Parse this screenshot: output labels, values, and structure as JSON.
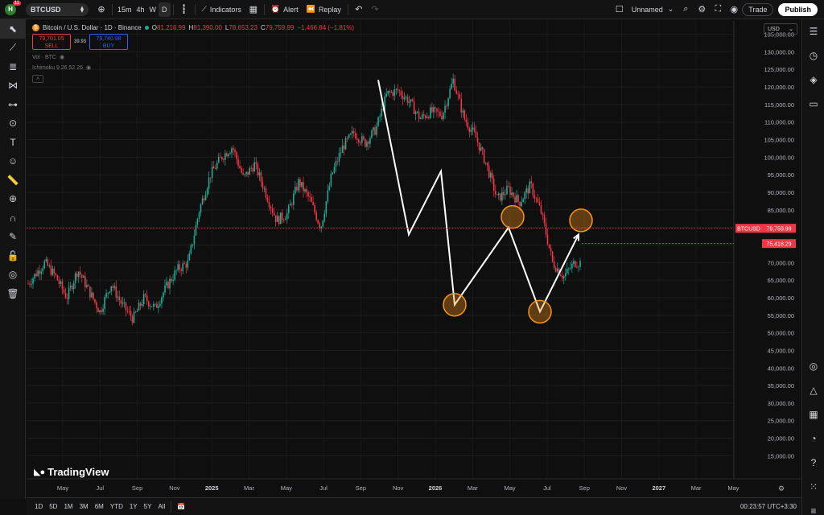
{
  "topbar": {
    "avatar_letter": "H",
    "notification_count": "11",
    "symbol": "BTCUSD",
    "timeframes": [
      "15m",
      "4h",
      "W",
      "D"
    ],
    "active_timeframe": "D",
    "indicators_label": "Indicators",
    "alert_label": "Alert",
    "replay_label": "Replay",
    "layout_name": "Unnamed",
    "trade_label": "Trade",
    "publish_label": "Publish"
  },
  "legend": {
    "title": "Bitcoin / U.S. Dollar · 1D · Binance",
    "o_label": "O",
    "o_value": "81,216.99",
    "h_label": "H",
    "h_value": "81,390.00",
    "l_label": "L",
    "l_value": "78,653.23",
    "c_label": "C",
    "c_value": "79,759.99",
    "change": "−1,466.84 (−1.81%)",
    "sell_price": "79,701.05",
    "sell_label": "SELL",
    "spread": "39.93",
    "buy_price": "79,740.98",
    "buy_label": "BUY",
    "vol_label": "Vol · BTC",
    "ichimoku_label": "Ichimoku 9 26 52 26"
  },
  "currency": "USD",
  "price_labels": {
    "symbol_tag": "BTCUSD",
    "last_price": "79,759.99",
    "line_price": "75,418.29"
  },
  "brand": "TradingView",
  "bottombar": {
    "ranges": [
      "1D",
      "5D",
      "1M",
      "3M",
      "6M",
      "YTD",
      "1Y",
      "5Y",
      "All"
    ],
    "clock": "00:23:57 UTC+3:30"
  },
  "colors": {
    "up": "#22ab94",
    "down": "#f23645",
    "background": "#0f0f0f",
    "circle": "#f7931a"
  },
  "chart_data": {
    "type": "candlestick",
    "y_axis_ticks": [
      15000,
      20000,
      25000,
      30000,
      35000,
      40000,
      45000,
      50000,
      55000,
      60000,
      65000,
      70000,
      75000,
      80000,
      85000,
      90000,
      95000,
      100000,
      105000,
      110000,
      115000,
      120000,
      125000,
      130000,
      135000
    ],
    "y_axis_labels": [
      "15,000.00",
      "20,000.00",
      "25,000.00",
      "30,000.00",
      "35,000.00",
      "40,000.00",
      "45,000.00",
      "50,000.00",
      "55,000.00",
      "60,000.00",
      "65,000.00",
      "70,000.00",
      "75,000.00",
      "80,000.00",
      "85,000.00",
      "90,000.00",
      "95,000.00",
      "100,000.00",
      "105,000.00",
      "110,000.00",
      "115,000.00",
      "120,000.00",
      "125,000.00",
      "130,000.00",
      "135,000.00"
    ],
    "x_axis_labels": [
      "May",
      "Jul",
      "Sep",
      "Nov",
      "2025",
      "Mar",
      "May",
      "Jul",
      "Sep",
      "Nov",
      "2026",
      "Mar",
      "May",
      "Jul",
      "Sep",
      "Nov",
      "2027",
      "Mar",
      "May"
    ],
    "x_axis_bold": [
      "2025",
      "2026",
      "2027"
    ],
    "ylim": [
      12000,
      138000
    ],
    "price_path": [
      [
        0,
        64000
      ],
      [
        0.03,
        70000
      ],
      [
        0.05,
        66000
      ],
      [
        0.07,
        60000
      ],
      [
        0.09,
        68000
      ],
      [
        0.11,
        62000
      ],
      [
        0.13,
        56000
      ],
      [
        0.15,
        64000
      ],
      [
        0.17,
        58000
      ],
      [
        0.19,
        54000
      ],
      [
        0.21,
        60000
      ],
      [
        0.23,
        57000
      ],
      [
        0.25,
        63000
      ],
      [
        0.27,
        68000
      ],
      [
        0.29,
        70000
      ],
      [
        0.31,
        85000
      ],
      [
        0.33,
        95000
      ],
      [
        0.35,
        100000
      ],
      [
        0.37,
        103000
      ],
      [
        0.39,
        94000
      ],
      [
        0.41,
        98000
      ],
      [
        0.43,
        90000
      ],
      [
        0.45,
        82000
      ],
      [
        0.47,
        84000
      ],
      [
        0.49,
        93000
      ],
      [
        0.51,
        88000
      ],
      [
        0.53,
        80000
      ],
      [
        0.55,
        95000
      ],
      [
        0.57,
        103000
      ],
      [
        0.59,
        107000
      ],
      [
        0.61,
        104000
      ],
      [
        0.63,
        108000
      ],
      [
        0.65,
        118000
      ],
      [
        0.67,
        119000
      ],
      [
        0.69,
        116000
      ],
      [
        0.71,
        111000
      ],
      [
        0.73,
        113000
      ],
      [
        0.75,
        112000
      ],
      [
        0.77,
        122000
      ],
      [
        0.79,
        111000
      ],
      [
        0.81,
        106000
      ],
      [
        0.83,
        98000
      ],
      [
        0.85,
        88000
      ],
      [
        0.87,
        91000
      ],
      [
        0.89,
        87000
      ],
      [
        0.91,
        92000
      ],
      [
        0.93,
        84000
      ],
      [
        0.95,
        70000
      ],
      [
        0.97,
        66000
      ],
      [
        0.99,
        70000
      ]
    ],
    "annotation_path": [
      [
        122000,
        0
      ],
      [
        78000,
        1
      ],
      [
        96000,
        2
      ],
      [
        58000,
        3
      ],
      [
        80000,
        4
      ],
      [
        56000,
        5
      ],
      [
        78000,
        6
      ]
    ],
    "annotation_circles": [
      58000,
      83000,
      56000,
      82000
    ],
    "last_price": 79760,
    "horizontal_line": 75418
  }
}
